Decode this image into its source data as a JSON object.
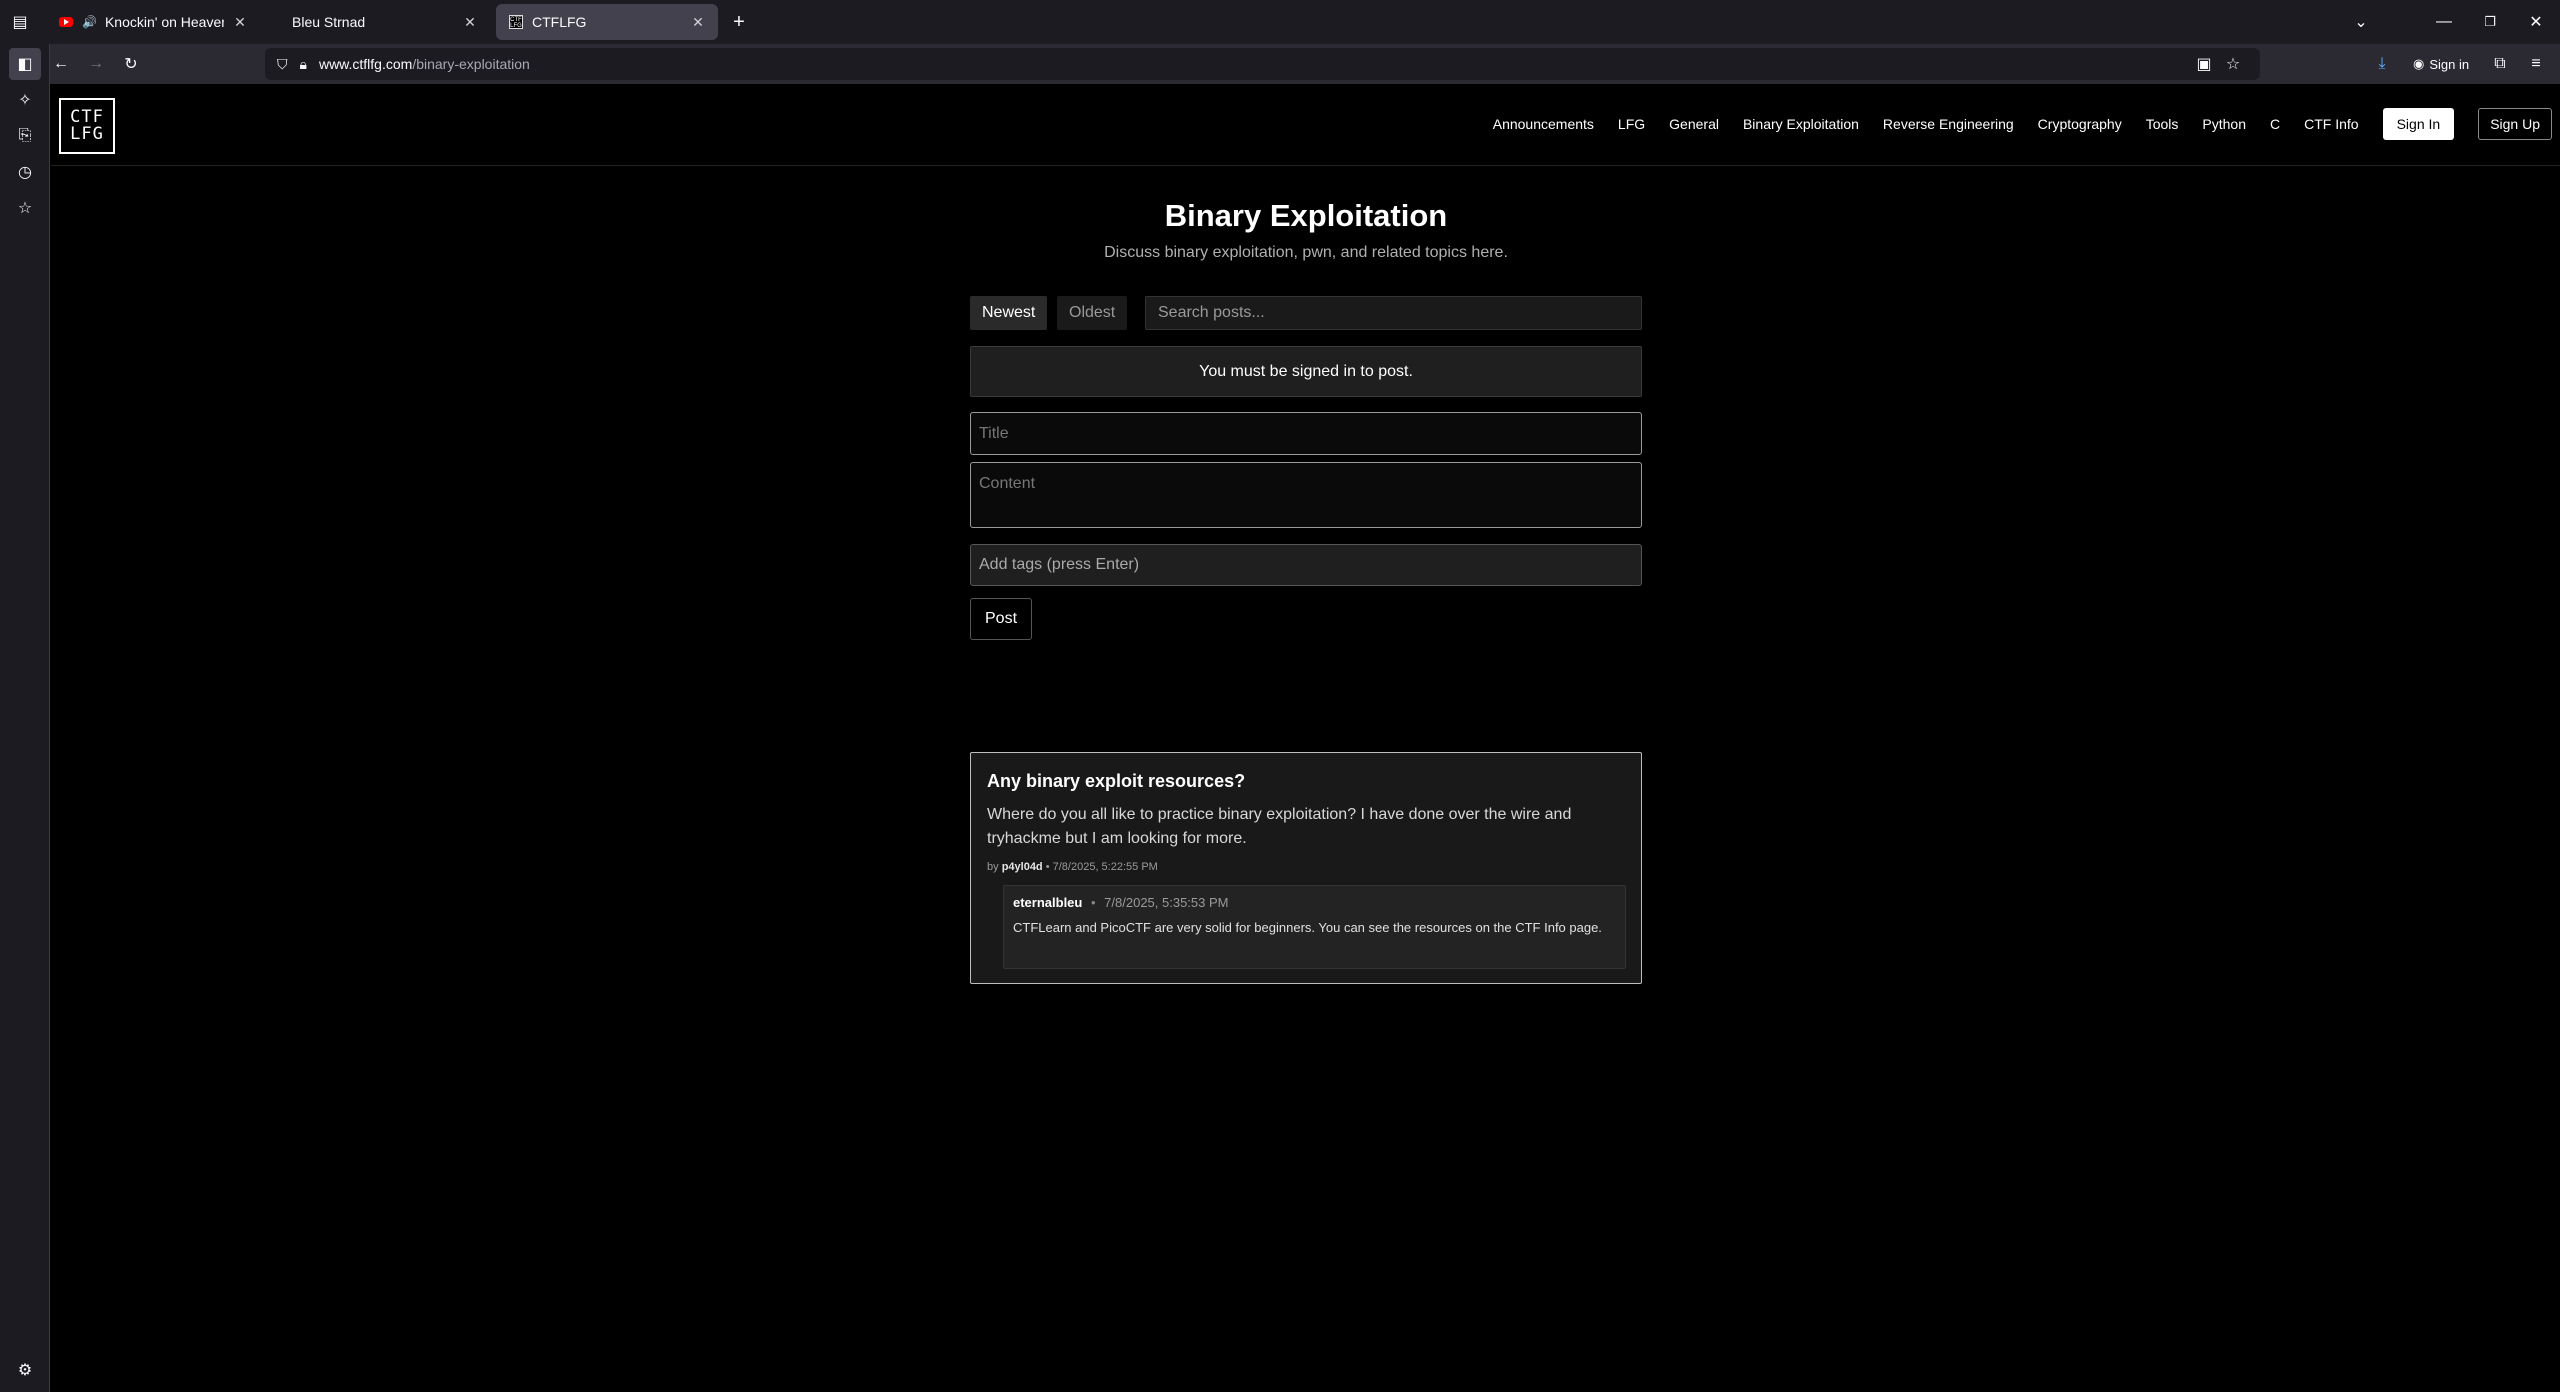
{
  "browser": {
    "tabs": [
      {
        "title": "Knockin' on Heaven's Door",
        "favicon": "youtube-icon",
        "audio": true,
        "active": false
      },
      {
        "title": "Bleu Strnad",
        "favicon": "none",
        "audio": false,
        "active": false
      },
      {
        "title": "CTFLFG",
        "favicon": "ctflfg-favicon",
        "audio": false,
        "active": true
      }
    ],
    "new_tab": "+",
    "url_host": "www.ctflfg.com",
    "url_path": "/binary-exploitation",
    "signin_label": "Sign in",
    "accent": "#42414d"
  },
  "site": {
    "logo_line1": "CTF",
    "logo_line2": "LFG",
    "nav": [
      "Announcements",
      "LFG",
      "General",
      "Binary Exploitation",
      "Reverse Engineering",
      "Cryptography",
      "Tools",
      "Python",
      "C",
      "CTF Info"
    ],
    "sign_in": "Sign In",
    "sign_up": "Sign Up"
  },
  "page": {
    "title": "Binary Exploitation",
    "subtitle": "Discuss binary exploitation, pwn, and related topics here.",
    "sort_newest": "Newest",
    "sort_oldest": "Oldest",
    "search_placeholder": "Search posts...",
    "notice": "You must be signed in to post.",
    "title_placeholder": "Title",
    "content_placeholder": "Content",
    "tags_placeholder": "Add tags (press Enter)",
    "post_button": "Post"
  },
  "posts": [
    {
      "title": "Any binary exploit resources?",
      "body": "Where do you all like to practice binary exploitation? I have done over the wire and tryhackme but I am looking for more.",
      "by": "by",
      "author": "p4yl04d",
      "timestamp": "• 7/8/2025, 5:22:55 PM",
      "replies": [
        {
          "author": "eternalbleu",
          "sep": "•",
          "timestamp": "7/8/2025, 5:35:53 PM",
          "body": "CTFLearn and PicoCTF are very solid for beginners. You can see the resources on the CTF Info page."
        }
      ]
    }
  ]
}
